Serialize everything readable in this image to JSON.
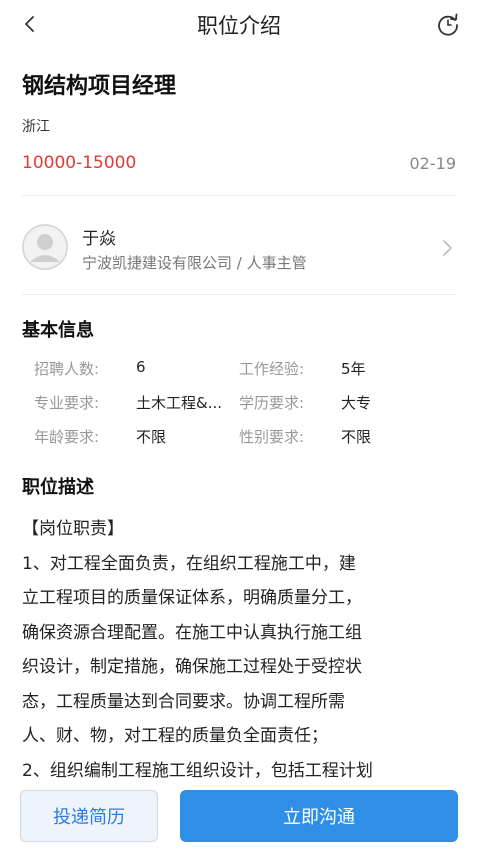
{
  "nav": {
    "title": "职位介绍",
    "back_icon": "chevron-left-icon",
    "refresh_icon": "refresh-icon"
  },
  "job": {
    "title": "钢结构项目经理",
    "city": "浙江",
    "salary": "10000-15000",
    "date": "02-19"
  },
  "recruiter": {
    "name": "于焱",
    "company": "宁波凯捷建设有限公司 / 人事主管"
  },
  "basic_info": {
    "heading": "基本信息",
    "rows": [
      {
        "k1": "招聘人数:",
        "v1": "6",
        "k2": "工作经验:",
        "v2": "5年"
      },
      {
        "k1": "专业要求:",
        "v1": "土木工程&...",
        "k2": "学历要求:",
        "v2": "大专"
      },
      {
        "k1": "年龄要求:",
        "v1": "不限",
        "k2": "性别要求:",
        "v2": "不限"
      }
    ]
  },
  "description": {
    "heading": "职位描述",
    "lines": [
      "【岗位职责】",
      "1、对工程全面负责，在组织工程施工中，建",
      "立工程项目的质量保证体系，明确质量分工，",
      "确保资源合理配置。在施工中认真执行施工组",
      "织设计，制定措施，确保施工过程处于受控状",
      "态，工程质量达到合同要求。协调工程所需",
      "人、财、物，对工程的质量负全面责任；",
      "2、组织编制工程施工组织设计，包括工程计划"
    ]
  },
  "actions": {
    "resume_label": "投递简历",
    "chat_label": "立即沟通"
  },
  "colors": {
    "salary": "#e53935",
    "primary": "#2f8ee6"
  }
}
